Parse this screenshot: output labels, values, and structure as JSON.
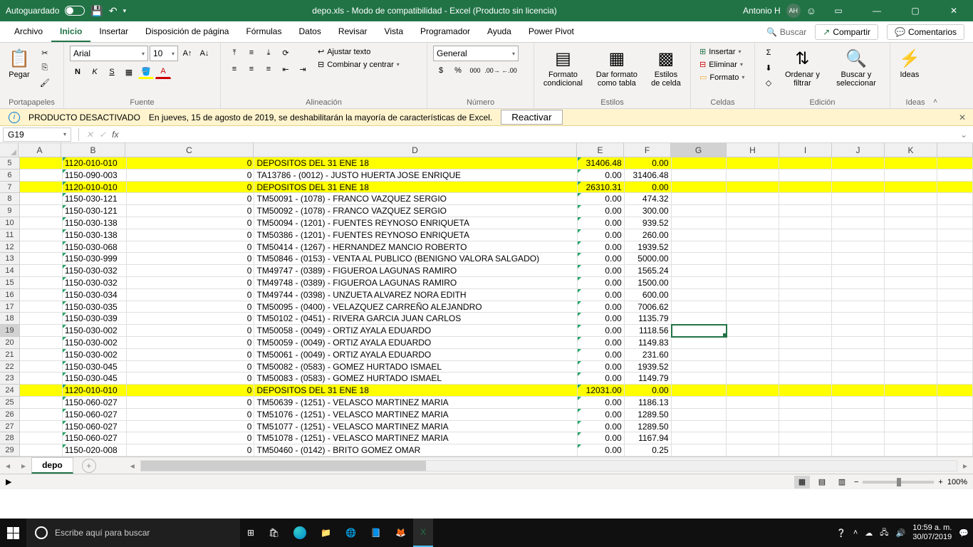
{
  "titlebar": {
    "autosave": "Autoguardado",
    "title": "depo.xls  -  Modo de compatibilidad  -  Excel (Producto sin licencia)",
    "user": "Antonio H",
    "initials": "AH"
  },
  "menu": {
    "tabs": [
      "Archivo",
      "Inicio",
      "Insertar",
      "Disposición de página",
      "Fórmulas",
      "Datos",
      "Revisar",
      "Vista",
      "Programador",
      "Ayuda",
      "Power Pivot"
    ],
    "active": 1,
    "search_ph": "Buscar",
    "share": "Compartir",
    "comments": "Comentarios"
  },
  "ribbon": {
    "clipboard": {
      "paste": "Pegar",
      "label": "Portapapeles"
    },
    "font": {
      "name": "Arial",
      "size": "10",
      "label": "Fuente",
      "bold": "N",
      "italic": "K",
      "underline": "S"
    },
    "align": {
      "wrap": "Ajustar texto",
      "merge": "Combinar y centrar",
      "label": "Alineación"
    },
    "number": {
      "format": "General",
      "label": "Número"
    },
    "styles": {
      "cond": "Formato condicional",
      "table": "Dar formato como tabla",
      "cell": "Estilos de celda",
      "label": "Estilos"
    },
    "cells": {
      "insert": "Insertar",
      "delete": "Eliminar",
      "format": "Formato",
      "label": "Celdas"
    },
    "editing": {
      "sort": "Ordenar y filtrar",
      "find": "Buscar y seleccionar",
      "label": "Edición"
    },
    "ideas": {
      "btn": "Ideas",
      "label": "Ideas"
    }
  },
  "warning": {
    "title": "PRODUCTO DESACTIVADO",
    "msg": "En jueves, 15 de agosto de 2019, se deshabilitarán la mayoría de características de Excel.",
    "btn": "Reactivar"
  },
  "namebox": "G19",
  "columns": [
    "A",
    "B",
    "C",
    "D",
    "E",
    "F",
    "G",
    "H",
    "I",
    "J",
    "K"
  ],
  "col_widths": [
    "col-A",
    "col-B",
    "col-C",
    "col-D",
    "col-E",
    "col-F",
    "col-G",
    "col-H",
    "col-I",
    "col-J",
    "col-K",
    "col-L"
  ],
  "sel_col_idx": 6,
  "sel_row": 19,
  "rows": [
    {
      "n": 5,
      "hl": true,
      "B": "1120-010-010",
      "C": "0",
      "D": "DEPOSITOS DEL 31 ENE 18",
      "E": "31406.48",
      "F": "0.00"
    },
    {
      "n": 6,
      "B": "1150-090-003",
      "C": "0",
      "D": "TA13786 - (0012) - JUSTO HUERTA JOSE ENRIQUE",
      "E": "0.00",
      "F": "31406.48"
    },
    {
      "n": 7,
      "hl": true,
      "B": "1120-010-010",
      "C": "0",
      "D": "DEPOSITOS DEL 31 ENE 18",
      "E": "26310.31",
      "F": "0.00"
    },
    {
      "n": 8,
      "B": "1150-030-121",
      "C": "0",
      "D": "TM50091 - (1078) - FRANCO VAZQUEZ SERGIO",
      "E": "0.00",
      "F": "474.32"
    },
    {
      "n": 9,
      "B": "1150-030-121",
      "C": "0",
      "D": "TM50092 - (1078) - FRANCO VAZQUEZ SERGIO",
      "E": "0.00",
      "F": "300.00"
    },
    {
      "n": 10,
      "B": "1150-030-138",
      "C": "0",
      "D": "TM50094 - (1201) - FUENTES REYNOSO ENRIQUETA",
      "E": "0.00",
      "F": "939.52"
    },
    {
      "n": 11,
      "B": "1150-030-138",
      "C": "0",
      "D": "TM50386 - (1201) - FUENTES REYNOSO ENRIQUETA",
      "E": "0.00",
      "F": "260.00"
    },
    {
      "n": 12,
      "B": "1150-030-068",
      "C": "0",
      "D": "TM50414 - (1267) - HERNANDEZ MANCIO ROBERTO",
      "E": "0.00",
      "F": "1939.52"
    },
    {
      "n": 13,
      "B": "1150-030-999",
      "C": "0",
      "D": "TM50846 - (0153) - VENTA AL PUBLICO (BENIGNO VALORA SALGADO)",
      "E": "0.00",
      "F": "5000.00"
    },
    {
      "n": 14,
      "B": "1150-030-032",
      "C": "0",
      "D": "TM49747 - (0389) - FIGUEROA LAGUNAS RAMIRO",
      "E": "0.00",
      "F": "1565.24"
    },
    {
      "n": 15,
      "B": "1150-030-032",
      "C": "0",
      "D": "TM49748 - (0389) - FIGUEROA LAGUNAS RAMIRO",
      "E": "0.00",
      "F": "1500.00"
    },
    {
      "n": 16,
      "B": "1150-030-034",
      "C": "0",
      "D": "TM49744 - (0398) - UNZUETA ALVAREZ NORA EDITH",
      "E": "0.00",
      "F": "600.00"
    },
    {
      "n": 17,
      "B": "1150-030-035",
      "C": "0",
      "D": "TM50095 - (0400) - VELAZQUEZ CARREÑO ALEJANDRO",
      "E": "0.00",
      "F": "7006.62"
    },
    {
      "n": 18,
      "B": "1150-030-039",
      "C": "0",
      "D": "TM50102 - (0451) - RIVERA GARCIA JUAN CARLOS",
      "E": "0.00",
      "F": "1135.79"
    },
    {
      "n": 19,
      "B": "1150-030-002",
      "C": "0",
      "D": "TM50058 - (0049) - ORTIZ AYALA EDUARDO",
      "E": "0.00",
      "F": "1118.56"
    },
    {
      "n": 20,
      "B": "1150-030-002",
      "C": "0",
      "D": "TM50059 - (0049) - ORTIZ AYALA EDUARDO",
      "E": "0.00",
      "F": "1149.83"
    },
    {
      "n": 21,
      "B": "1150-030-002",
      "C": "0",
      "D": "TM50061 - (0049) - ORTIZ AYALA EDUARDO",
      "E": "0.00",
      "F": "231.60"
    },
    {
      "n": 22,
      "B": "1150-030-045",
      "C": "0",
      "D": "TM50082 - (0583) - GOMEZ HURTADO ISMAEL",
      "E": "0.00",
      "F": "1939.52"
    },
    {
      "n": 23,
      "B": "1150-030-045",
      "C": "0",
      "D": "TM50083 - (0583) - GOMEZ HURTADO ISMAEL",
      "E": "0.00",
      "F": "1149.79"
    },
    {
      "n": 24,
      "hl": true,
      "B": "1120-010-010",
      "C": "0",
      "D": "DEPOSITOS DEL 31 ENE 18",
      "E": "12031.00",
      "F": "0.00"
    },
    {
      "n": 25,
      "B": "1150-060-027",
      "C": "0",
      "D": "TM50639 - (1251) - VELASCO MARTINEZ MARIA",
      "E": "0.00",
      "F": "1186.13"
    },
    {
      "n": 26,
      "B": "1150-060-027",
      "C": "0",
      "D": "TM51076 - (1251) - VELASCO MARTINEZ MARIA",
      "E": "0.00",
      "F": "1289.50"
    },
    {
      "n": 27,
      "B": "1150-060-027",
      "C": "0",
      "D": "TM51077 - (1251) - VELASCO MARTINEZ MARIA",
      "E": "0.00",
      "F": "1289.50"
    },
    {
      "n": 28,
      "B": "1150-060-027",
      "C": "0",
      "D": "TM51078 - (1251) - VELASCO MARTINEZ MARIA",
      "E": "0.00",
      "F": "1167.94"
    },
    {
      "n": 29,
      "B": "1150-020-008",
      "C": "0",
      "D": "TM50460 - (0142) - BRITO GOMEZ OMAR",
      "E": "0.00",
      "F": "0.25"
    }
  ],
  "sheet": {
    "name": "depo"
  },
  "zoom": "100%",
  "taskbar": {
    "search_ph": "Escribe aquí para buscar",
    "time": "10:59 a. m.",
    "date": "30/07/2019"
  }
}
